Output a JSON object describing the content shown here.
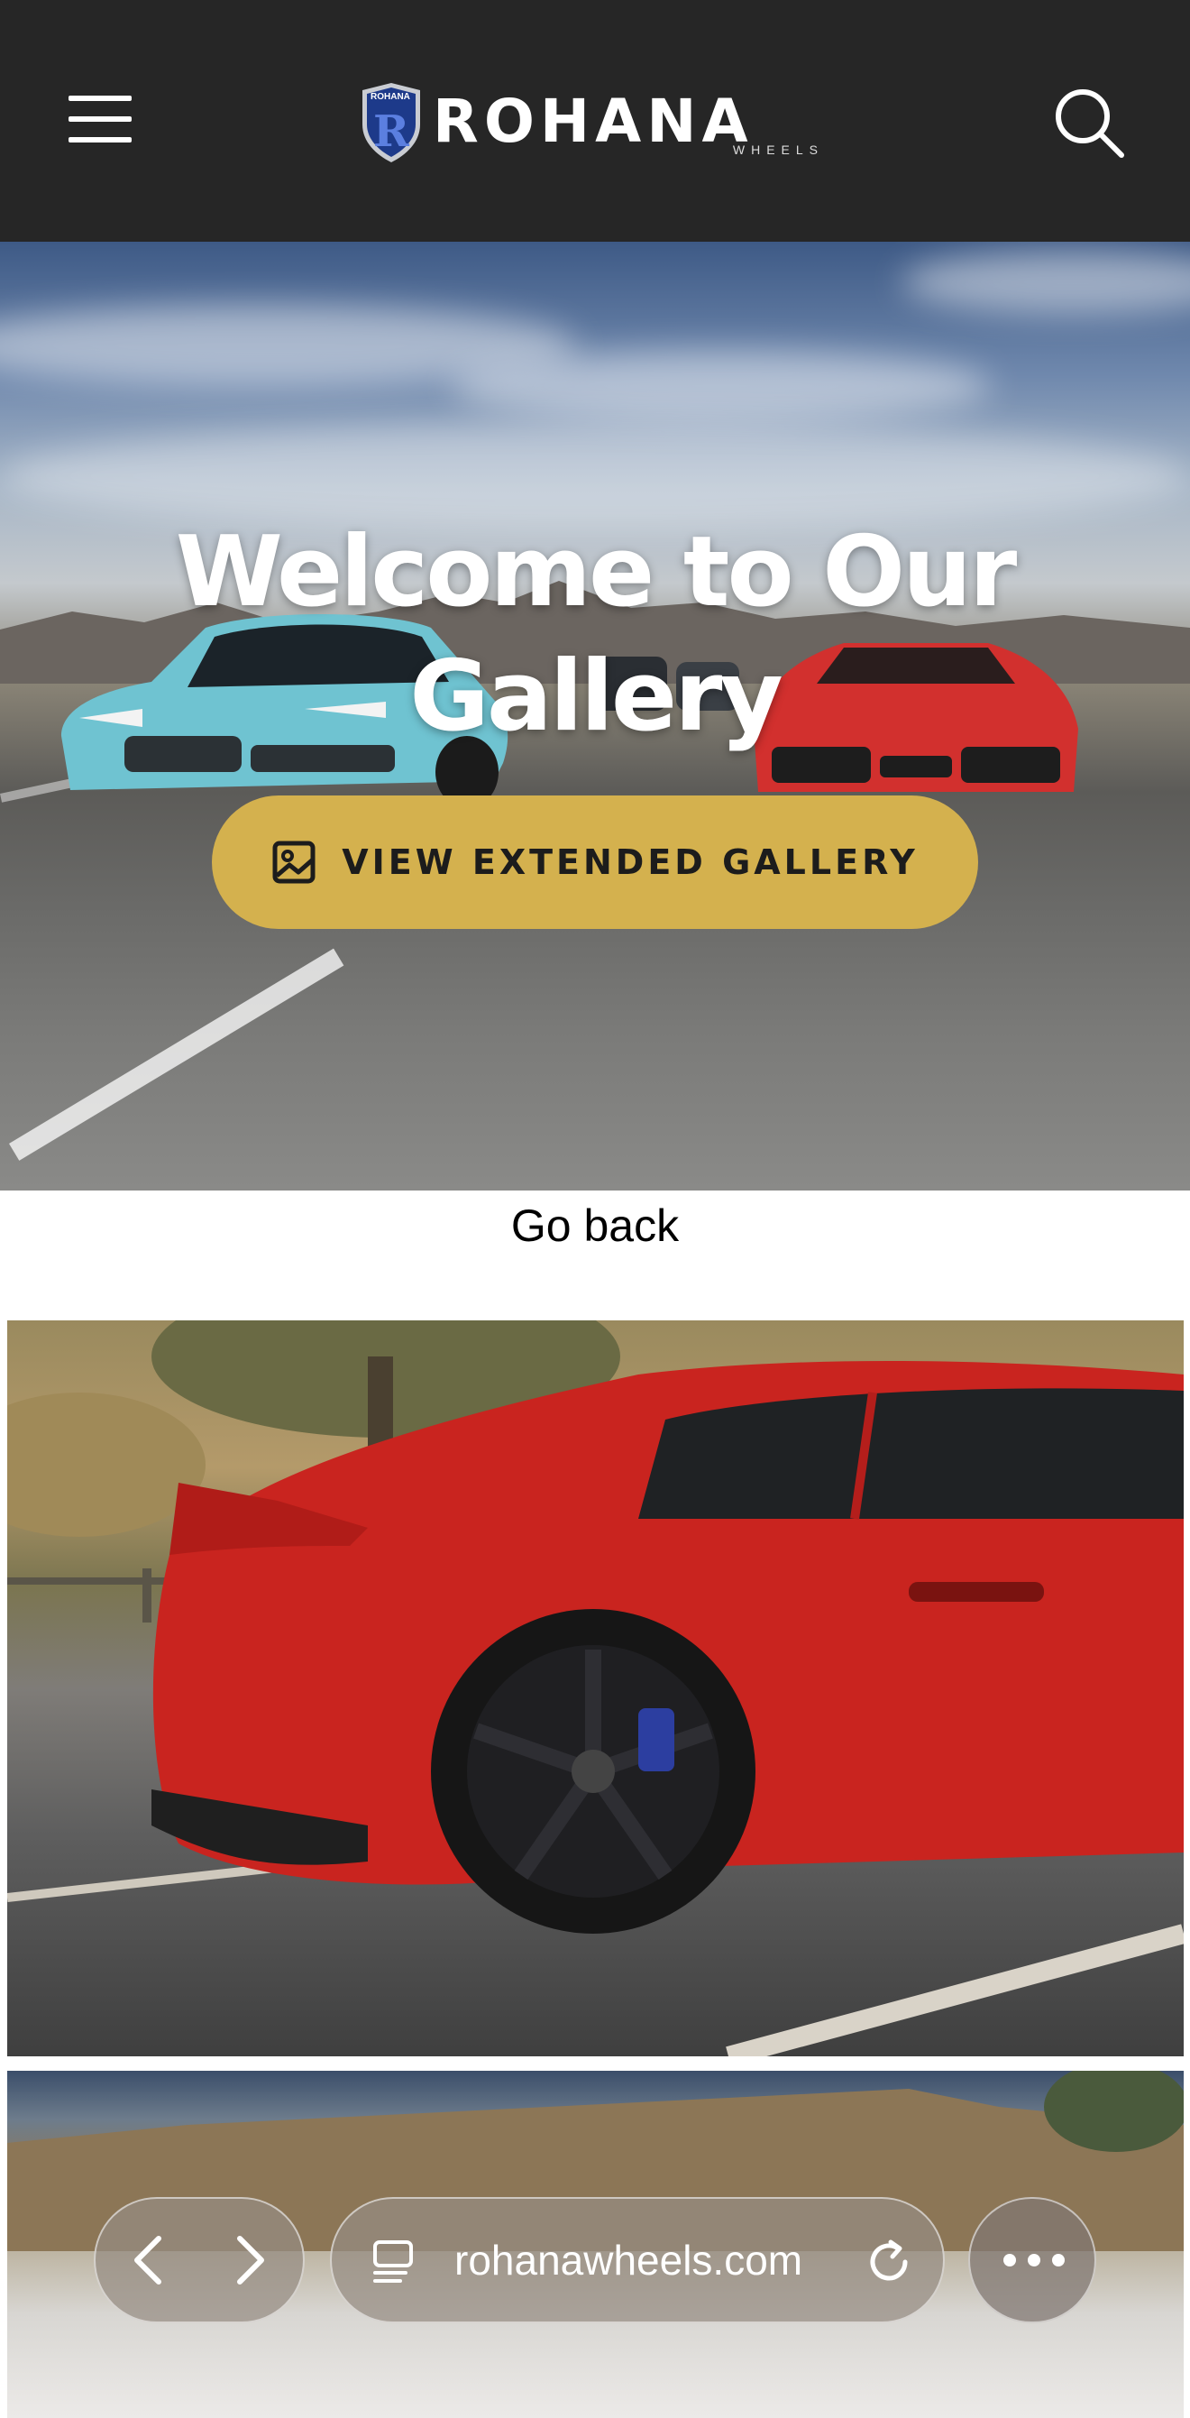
{
  "header": {
    "brand": "ROHANA",
    "brand_sub": "WHEELS",
    "badge_text": "ROHANA",
    "menu_icon": "hamburger-menu-icon",
    "search_icon": "search-icon",
    "background": "#262626"
  },
  "hero": {
    "title": "Welcome to Our Gallery",
    "cta_label": "VIEW EXTENDED GALLERY",
    "cta_icon": "image-icon",
    "cta_color": "#d4b14e"
  },
  "gallery": {
    "go_back": "Go back",
    "images": [
      "red-coupe-black-wheel-photo",
      "mountain-landscape-photo"
    ]
  },
  "browser": {
    "url": "rohanawheels.com",
    "back_icon": "chevron-left-icon",
    "forward_icon": "chevron-right-icon",
    "tabs_icon": "page-icon",
    "reload_icon": "reload-icon",
    "more_icon": "more-dots-icon"
  }
}
